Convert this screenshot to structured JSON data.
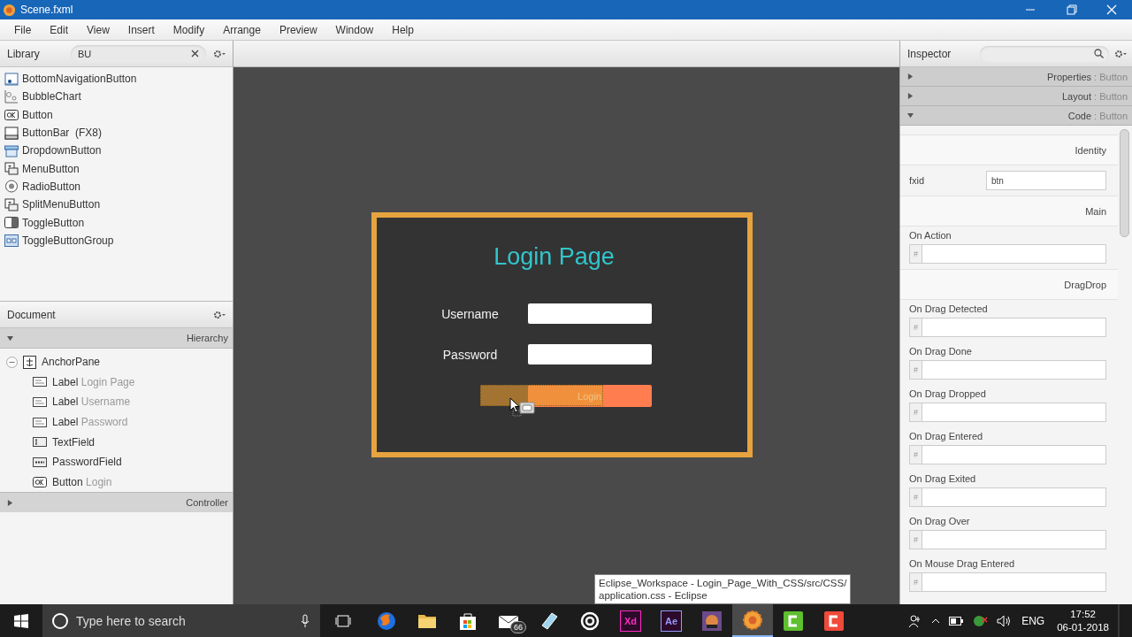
{
  "window": {
    "title": "Scene.fxml"
  },
  "menu": [
    "File",
    "Edit",
    "View",
    "Insert",
    "Modify",
    "Arrange",
    "Preview",
    "Window",
    "Help"
  ],
  "library": {
    "title": "Library",
    "search": {
      "value": "BU"
    },
    "items": [
      {
        "label": "BottomNavigationButton",
        "kind": "nav"
      },
      {
        "label": "BubbleChart",
        "kind": "chart"
      },
      {
        "label": "Button",
        "kind": "ok"
      },
      {
        "label": "ButtonBar  (FX8)",
        "kind": "bar"
      },
      {
        "label": "DropdownButton",
        "kind": "dropdown"
      },
      {
        "label": "MenuButton",
        "kind": "menu"
      },
      {
        "label": "RadioButton",
        "kind": "radio"
      },
      {
        "label": "SplitMenuButton",
        "kind": "menu"
      },
      {
        "label": "ToggleButton",
        "kind": "toggle"
      },
      {
        "label": "ToggleButtonGroup",
        "kind": "group"
      }
    ]
  },
  "document": {
    "title": "Document",
    "section": {
      "label": "Hierarchy",
      "expanded": true
    },
    "tree": [
      {
        "type": "AnchorPane",
        "kind": "anchor",
        "expanded": true,
        "children": [
          {
            "type": "Label",
            "text": "Login Page",
            "kind": "label"
          },
          {
            "type": "Label",
            "text": "Username",
            "kind": "label"
          },
          {
            "type": "Label",
            "text": "Password",
            "kind": "label"
          },
          {
            "type": "TextField",
            "kind": "text"
          },
          {
            "type": "PasswordField",
            "kind": "password"
          },
          {
            "type": "Button",
            "text": "Login",
            "kind": "ok"
          }
        ]
      }
    ],
    "footer": {
      "label": "Controller",
      "expanded": false
    }
  },
  "canvas": {
    "title": "Login Page",
    "fields": [
      {
        "label": "Username"
      },
      {
        "label": "Password"
      }
    ],
    "button": "Login"
  },
  "inspector": {
    "title": "Inspector",
    "sections": [
      {
        "name": "Properties",
        "type": ": Button",
        "expanded": false
      },
      {
        "name": "Layout",
        "type": ": Button",
        "expanded": false
      },
      {
        "name": "Code",
        "type": ": Button",
        "expanded": true
      }
    ],
    "rows": [
      {
        "kind": "header",
        "text": "Identity"
      },
      {
        "kind": "inline",
        "label": "fxid",
        "value": "btn"
      },
      {
        "kind": "header",
        "text": "Main"
      },
      {
        "kind": "field",
        "label": "On Action",
        "prefix": "#"
      },
      {
        "kind": "header",
        "text": "DragDrop"
      },
      {
        "kind": "field",
        "label": "On Drag Detected",
        "prefix": "#"
      },
      {
        "kind": "field",
        "label": "On Drag Done",
        "prefix": "#"
      },
      {
        "kind": "field",
        "label": "On Drag Dropped",
        "prefix": "#"
      },
      {
        "kind": "field",
        "label": "On Drag Entered",
        "prefix": "#"
      },
      {
        "kind": "field",
        "label": "On Drag Exited",
        "prefix": "#"
      },
      {
        "kind": "field",
        "label": "On Drag Over",
        "prefix": "#"
      },
      {
        "kind": "field",
        "label": "On Mouse Drag Entered",
        "prefix": "#"
      }
    ]
  },
  "tooltip": {
    "lines": [
      "Eclipse_Workspace - Login_Page_With_CSS/src/CSS/",
      "application.css - Eclipse"
    ]
  },
  "taskbar": {
    "search": {
      "placeholder": "Type here to search"
    },
    "apps": [
      {
        "kind": "browser",
        "active": false
      },
      {
        "kind": "folder",
        "active": false
      },
      {
        "kind": "store",
        "active": false
      },
      {
        "kind": "mail",
        "badge": "66",
        "active": false
      },
      {
        "kind": "notes",
        "active": false
      },
      {
        "kind": "disc",
        "active": false
      },
      {
        "kind": "tile",
        "label": "Xd",
        "color": "#ff2bc2",
        "active": false
      },
      {
        "kind": "tile",
        "label": "Ae",
        "color": "#9999ff",
        "active": false
      },
      {
        "kind": "game",
        "active": false
      },
      {
        "kind": "builder",
        "active": true
      },
      {
        "kind": "letter",
        "color": "#5fbf2f",
        "active": false
      },
      {
        "kind": "letter",
        "color": "#f04a3a",
        "active": false
      }
    ],
    "tray": {
      "language": "ENG",
      "time": "17:52",
      "date": "06-01-2018"
    }
  }
}
